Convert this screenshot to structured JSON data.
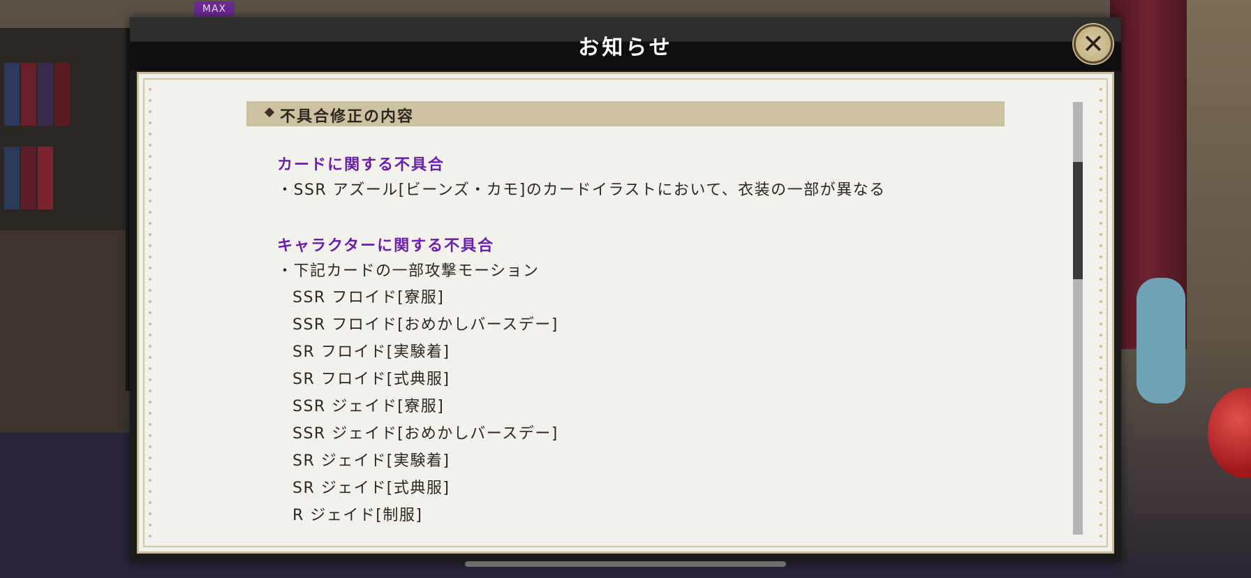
{
  "badge": {
    "max_label": "MAX"
  },
  "dialog": {
    "title": "お知らせ",
    "close_icon": "close-icon",
    "close_glyph": "✕"
  },
  "notice": {
    "section_title": "不具合修正の内容",
    "card_heading": "カードに関する不具合",
    "card_items": [
      "・SSR アズール[ビーンズ・カモ]のカードイラストにおいて、衣装の一部が異なる"
    ],
    "character_heading": "キャラクターに関する不具合",
    "character_intro": "・下記カードの一部攻撃モーション",
    "character_cards": [
      "SSR フロイド[寮服]",
      "SSR フロイド[おめかしバースデー]",
      "SR フロイド[実験着]",
      "SR フロイド[式典服]",
      "SSR ジェイド[寮服]",
      "SSR ジェイド[おめかしバースデー]",
      "SR ジェイド[実験着]",
      "SR ジェイド[式典服]",
      "R ジェイド[制服]"
    ]
  },
  "colors": {
    "heading": "#6a1fa8",
    "paper": "#f3f1ec",
    "section_bar": "#cdc3a3",
    "close_button": "#d9c9a2"
  }
}
